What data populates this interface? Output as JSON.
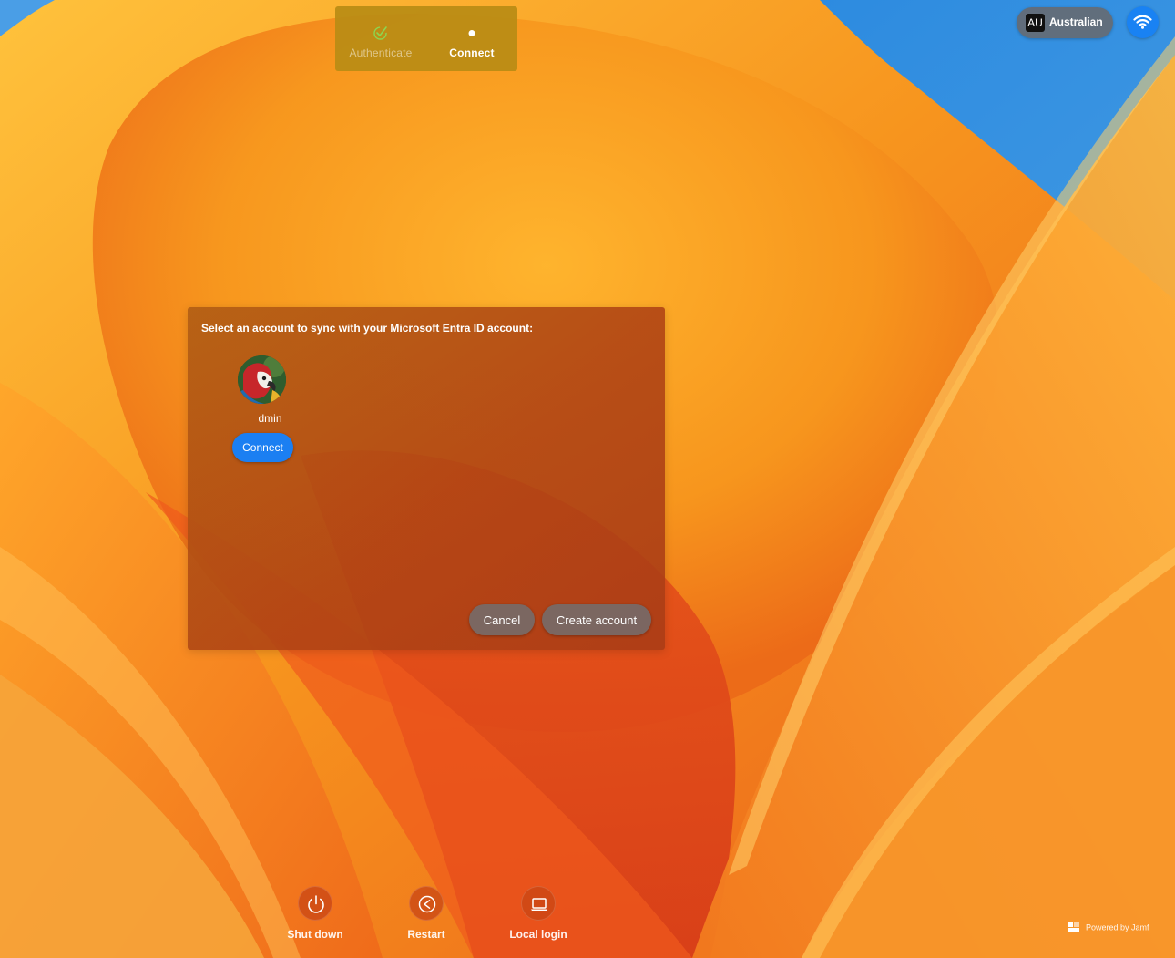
{
  "progress": {
    "steps": [
      {
        "label": "Authenticate",
        "state": "completed",
        "icon": "checkmark-icon"
      },
      {
        "label": "Connect",
        "state": "current",
        "icon": "dot-icon"
      }
    ]
  },
  "top_right": {
    "keyboard": {
      "badge": "AU",
      "label": "Australian"
    },
    "wifi": {
      "icon": "wifi-icon"
    }
  },
  "dialog": {
    "title": "Select an account to sync with your Microsoft Entra ID account:",
    "account": {
      "name": "dmin",
      "avatar_icon": "parrot-avatar"
    },
    "connect_label": "Connect",
    "cancel_label": "Cancel",
    "create_account_label": "Create account"
  },
  "bottom_actions": [
    {
      "label": "Shut down",
      "icon": "power-icon"
    },
    {
      "label": "Restart",
      "icon": "restart-icon"
    },
    {
      "label": "Local login",
      "icon": "laptop-icon"
    }
  ],
  "footer": {
    "powered_by": "Powered by Jamf"
  },
  "colors": {
    "accent_blue": "#1b7ff2",
    "check_green": "#8cd650",
    "wallpaper_orange": "#f08a1c"
  }
}
